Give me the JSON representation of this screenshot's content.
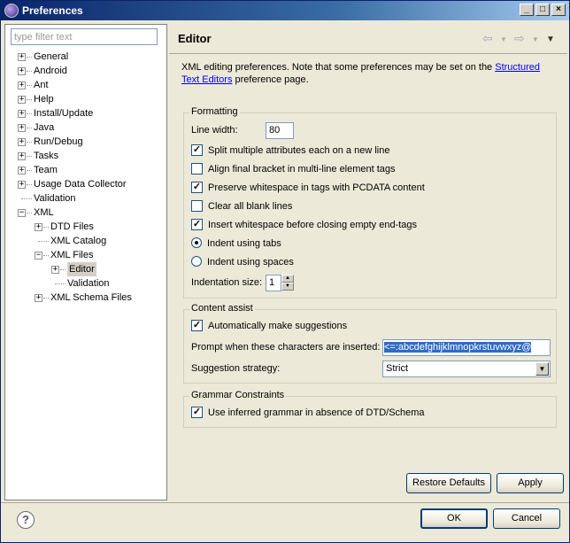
{
  "window": {
    "title": "Preferences"
  },
  "filter": {
    "placeholder": "type filter text"
  },
  "tree": [
    {
      "label": "General",
      "expander": "+"
    },
    {
      "label": "Android",
      "expander": "+"
    },
    {
      "label": "Ant",
      "expander": "+"
    },
    {
      "label": "Help",
      "expander": "+"
    },
    {
      "label": "Install/Update",
      "expander": "+"
    },
    {
      "label": "Java",
      "expander": "+"
    },
    {
      "label": "Run/Debug",
      "expander": "+"
    },
    {
      "label": "Tasks",
      "expander": "+"
    },
    {
      "label": "Team",
      "expander": "+"
    },
    {
      "label": "Usage Data Collector",
      "expander": "+"
    },
    {
      "label": "Validation",
      "expander": ""
    },
    {
      "label": "XML",
      "expander": "-"
    },
    {
      "label": "DTD Files",
      "expander": "+"
    },
    {
      "label": "XML Catalog",
      "expander": ""
    },
    {
      "label": "XML Files",
      "expander": "-"
    },
    {
      "label": "Editor",
      "expander": "+",
      "selected": true
    },
    {
      "label": "Validation",
      "expander": ""
    },
    {
      "label": "XML Schema Files",
      "expander": "+"
    }
  ],
  "page": {
    "title": "Editor",
    "description_before": "XML editing preferences.  Note that some preferences may be set on the ",
    "description_link": "Structured Text Editors",
    "description_after": " preference page."
  },
  "formatting": {
    "title": "Formatting",
    "line_width_label": "Line width:",
    "line_width_value": "80",
    "split_attributes": {
      "label": "Split multiple attributes each on a new line",
      "checked": true
    },
    "align_bracket": {
      "label": "Align final bracket in multi-line element tags",
      "checked": false
    },
    "preserve_whitespace": {
      "label": "Preserve whitespace in tags with PCDATA content",
      "checked": true
    },
    "clear_blank": {
      "label": "Clear all blank lines",
      "checked": false
    },
    "insert_whitespace": {
      "label": "Insert whitespace before closing empty end-tags",
      "checked": true
    },
    "indent_tabs": {
      "label": "Indent using tabs",
      "selected": true
    },
    "indent_spaces": {
      "label": "Indent using spaces",
      "selected": false
    },
    "indentation_size_label": "Indentation size:",
    "indentation_size_value": "1"
  },
  "content_assist": {
    "title": "Content assist",
    "auto_suggest": {
      "label": "Automatically make suggestions",
      "checked": true
    },
    "prompt_label": "Prompt when these characters are inserted:",
    "prompt_value": "<=:abcdefghijklmnopkrstuvwxyz@",
    "strategy_label": "Suggestion strategy:",
    "strategy_value": "Strict"
  },
  "grammar": {
    "title": "Grammar Constraints",
    "use_inferred": {
      "label": "Use inferred grammar in absence of DTD/Schema",
      "checked": true
    }
  },
  "buttons": {
    "restore_defaults": "Restore Defaults",
    "apply": "Apply",
    "ok": "OK",
    "cancel": "Cancel"
  },
  "colors": {
    "title_bar": "#0a246a",
    "link": "#0000ee",
    "selection": "#316ac5"
  }
}
